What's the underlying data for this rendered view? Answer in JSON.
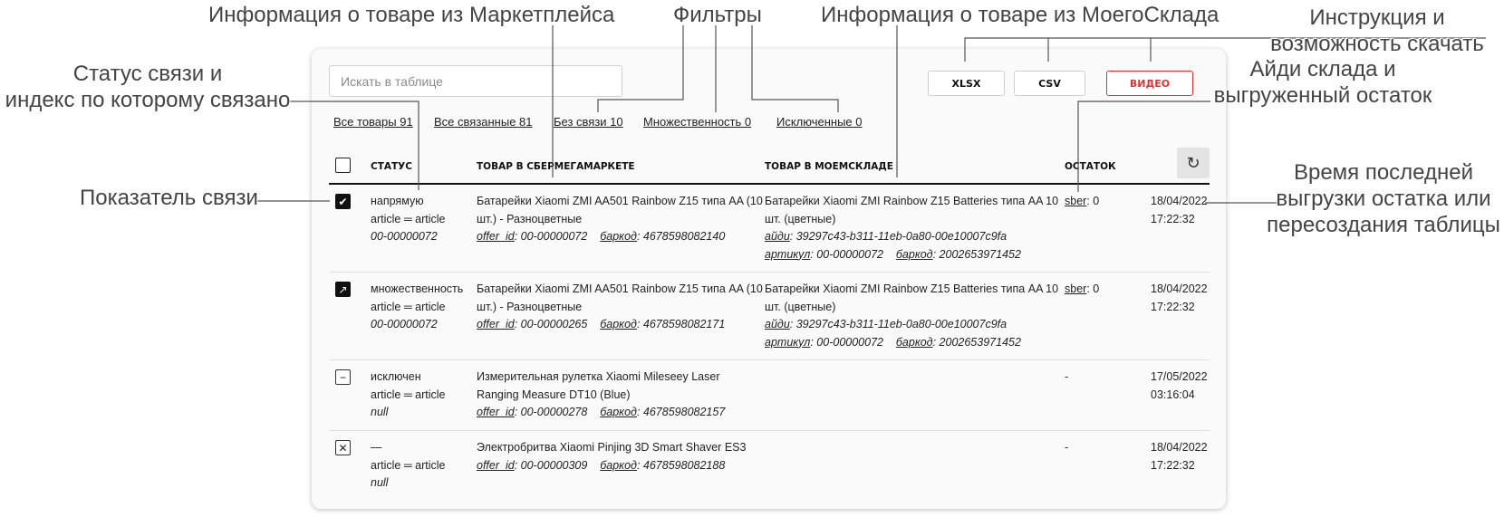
{
  "annotations": {
    "market_info": "Информация о товаре из Маркетплейса",
    "filters": "Фильтры",
    "ms_info": "Информация о товаре из МоегоСклада",
    "instructions_1": "Инструкция и",
    "instructions_2": "возможность скачать",
    "status_1": "Статус связи и",
    "status_2": "индекс по которому связано",
    "stock_1": "Айди склада и",
    "stock_2": "выгруженный остаток",
    "indicator": "Показатель связи",
    "time_1": "Время последней",
    "time_2": "выгрузки остатка или",
    "time_3": "пересоздания таблицы"
  },
  "search": {
    "placeholder": "Искать в таблице"
  },
  "buttons": {
    "xlsx": "XLSX",
    "csv": "CSV",
    "video": "ВИДЕО"
  },
  "filters": {
    "all": "Все товары 91",
    "linked": "Все связанные 81",
    "unlinked": "Без связи 10",
    "multiple": "Множественность 0",
    "excluded": "Исключенные 0"
  },
  "columns": {
    "status": "СТАТУС",
    "market": "ТОВАР В СБЕРМЕГАМАРКЕТЕ",
    "ms": "ТОВАР В МОЕМСКЛАДЕ",
    "stock": "ОСТАТОК"
  },
  "icons": {
    "refresh": "refresh-icon",
    "check": "check-icon",
    "link": "arrow-up-right-icon",
    "minus": "minus-icon",
    "close": "close-icon"
  },
  "labels": {
    "offer_id": "offer_id",
    "barcode": "баркод",
    "aydi": "айди",
    "article": "артикул"
  },
  "rows": [
    {
      "status": "напрямую",
      "index": "article ═ article",
      "index_value": "00-00000072",
      "market_name_1": "Батарейки Xiaomi ZMI AA501 Rainbow Z15 типа AA (10",
      "market_name_2": "шт.) - Разноцветные",
      "offer_id": "00-00000072",
      "barcode": "4678598082140",
      "ms_name_1": "Батарейки Xiaomi ZMI Rainbow Z15 Batteries типа AA 10",
      "ms_name_2": "шт. (цветные)",
      "ms_id": "39297c43-b311-11eb-0a80-00e10007c9fa",
      "ms_article": "00-00000072",
      "ms_barcode": "2002653971452",
      "stock_name": "sber",
      "stock_value": ": 0",
      "date": "18/04/2022",
      "time": "17:22:32"
    },
    {
      "status": "множественность",
      "index": "article ═ article",
      "index_value": "00-00000072",
      "market_name_1": "Батарейки Xiaomi ZMI AA501 Rainbow Z15 типа AA (10",
      "market_name_2": "шт.) - Разноцветные",
      "offer_id": "00-00000265",
      "barcode": "4678598082171",
      "ms_name_1": "Батарейки Xiaomi ZMI Rainbow Z15 Batteries типа AA 10",
      "ms_name_2": "шт. (цветные)",
      "ms_id": "39297c43-b311-11eb-0a80-00e10007c9fa",
      "ms_article": "00-00000072",
      "ms_barcode": "2002653971452",
      "stock_name": "sber",
      "stock_value": ": 0",
      "date": "18/04/2022",
      "time": "17:22:32"
    },
    {
      "status": "исключен",
      "index": "article ═ article",
      "index_value": "null",
      "market_name_1": "Измерительная рулетка Xiaomi Mileseey Laser",
      "market_name_2": "Ranging Measure DT10 (Blue)",
      "offer_id": "00-00000278",
      "barcode": "4678598082157",
      "stock_dash": "-",
      "date": "17/05/2022",
      "time": "03:16:04"
    },
    {
      "status": "—",
      "index": "article ═ article",
      "index_value": "null",
      "market_name_1": "Электробритва Xiaomi Pinjing 3D Smart Shaver ES3",
      "offer_id": "00-00000309",
      "barcode": "4678598082188",
      "stock_dash": "-",
      "date": "18/04/2022",
      "time": "17:22:32"
    }
  ]
}
